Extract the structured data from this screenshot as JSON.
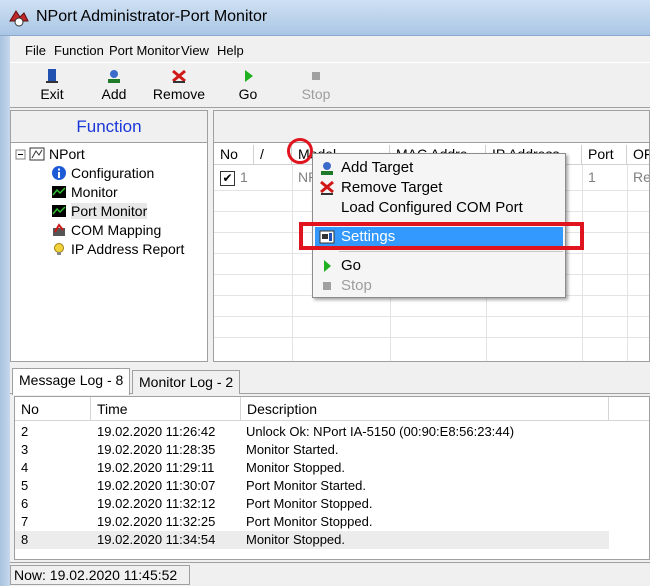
{
  "window": {
    "title": "NPort Administrator-Port Monitor",
    "icon": "nport-app-icon"
  },
  "menu": [
    {
      "label": "File",
      "accel": "F"
    },
    {
      "label": "Function",
      "accel": "F"
    },
    {
      "label": "Port Monitor",
      "accel": ""
    },
    {
      "label": "View",
      "accel": "V"
    },
    {
      "label": "Help",
      "accel": "H"
    }
  ],
  "toolbar": {
    "exit": "Exit",
    "add": "Add",
    "remove": "Remove",
    "go": "Go",
    "stop": "Stop"
  },
  "function_panel": {
    "title": "Function",
    "tree": {
      "root": "NPort",
      "items": [
        "Configuration",
        "Monitor",
        "Port Monitor",
        "COM Mapping",
        "IP Address Report"
      ],
      "selected": "Port Monitor"
    }
  },
  "grid": {
    "columns": [
      "No",
      "/",
      "Model",
      "MAC Addre",
      "IP Address",
      "Port",
      "OF"
    ],
    "row": {
      "checked": "✔",
      "no": "1",
      "model": "NP",
      "port": "1",
      "of": "Re"
    }
  },
  "context_menu": {
    "items": [
      {
        "label": "Add Target",
        "icon": "add-target-icon"
      },
      {
        "label": "Remove Target",
        "icon": "remove-target-icon"
      },
      {
        "label": "Load Configured COM Port",
        "icon": ""
      },
      {
        "label": "Settings",
        "icon": "settings-icon",
        "highlighted": true
      },
      {
        "label": "Go",
        "icon": "go-icon"
      },
      {
        "label": "Stop",
        "icon": "stop-icon",
        "disabled": true
      }
    ]
  },
  "log_tabs": [
    {
      "label": "Message Log - 8",
      "active": true
    },
    {
      "label": "Monitor Log - 2",
      "active": false
    }
  ],
  "log": {
    "columns": [
      "No",
      "Time",
      "Description"
    ],
    "rows": [
      {
        "no": "2",
        "time": "19.02.2020 11:26:42",
        "desc": "Unlock Ok: NPort IA-5150 (00:90:E8:56:23:44)"
      },
      {
        "no": "3",
        "time": "19.02.2020 11:28:35",
        "desc": "Monitor Started."
      },
      {
        "no": "4",
        "time": "19.02.2020 11:29:11",
        "desc": "Monitor Stopped."
      },
      {
        "no": "5",
        "time": "19.02.2020 11:30:07",
        "desc": "Port Monitor Started."
      },
      {
        "no": "6",
        "time": "19.02.2020 11:32:12",
        "desc": "Port Monitor Stopped."
      },
      {
        "no": "7",
        "time": "19.02.2020 11:32:25",
        "desc": "Port Monitor Stopped."
      },
      {
        "no": "8",
        "time": "19.02.2020 11:34:54",
        "desc": "Monitor Stopped."
      }
    ]
  },
  "status": {
    "now": "Now: 19.02.2020 11:45:52"
  },
  "colors": {
    "function_title": "#1a37d9",
    "highlight": "#3399ff",
    "annotation_red": "#e0141e"
  }
}
